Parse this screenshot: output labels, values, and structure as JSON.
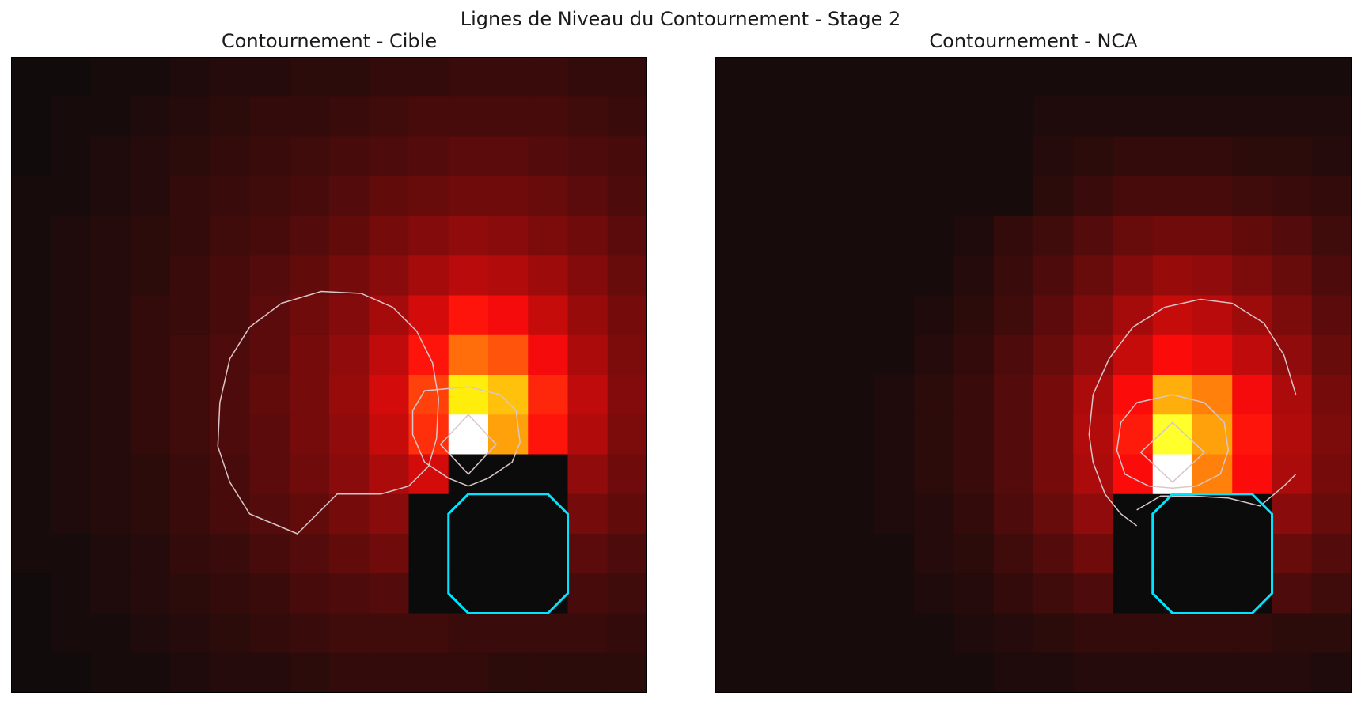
{
  "figure": {
    "suptitle": "Lignes de Niveau du Contournement - Stage 2"
  },
  "chart_data": [
    {
      "type": "heatmap",
      "title": "Contournement - Cible",
      "colormap": "hot",
      "grid_size": 16,
      "xticks": [],
      "yticks": [],
      "values": [
        [
          0.01,
          0.01,
          0.02,
          0.02,
          0.03,
          0.04,
          0.04,
          0.05,
          0.05,
          0.06,
          0.06,
          0.07,
          0.07,
          0.07,
          0.06,
          0.06
        ],
        [
          0.01,
          0.02,
          0.02,
          0.03,
          0.04,
          0.05,
          0.06,
          0.06,
          0.07,
          0.08,
          0.09,
          0.09,
          0.09,
          0.09,
          0.08,
          0.07
        ],
        [
          0.01,
          0.02,
          0.03,
          0.04,
          0.05,
          0.06,
          0.07,
          0.08,
          0.09,
          0.1,
          0.11,
          0.12,
          0.12,
          0.11,
          0.1,
          0.09
        ],
        [
          0.02,
          0.02,
          0.03,
          0.04,
          0.06,
          0.07,
          0.08,
          0.09,
          0.11,
          0.13,
          0.14,
          0.15,
          0.15,
          0.14,
          0.12,
          0.1
        ],
        [
          0.02,
          0.03,
          0.04,
          0.05,
          0.06,
          0.08,
          0.09,
          0.11,
          0.13,
          0.16,
          0.18,
          0.2,
          0.19,
          0.17,
          0.15,
          0.12
        ],
        [
          0.02,
          0.03,
          0.04,
          0.05,
          0.07,
          0.09,
          0.11,
          0.13,
          0.16,
          0.19,
          0.23,
          0.26,
          0.25,
          0.22,
          0.18,
          0.14
        ],
        [
          0.02,
          0.03,
          0.04,
          0.06,
          0.07,
          0.09,
          0.12,
          0.15,
          0.18,
          0.23,
          0.3,
          0.38,
          0.35,
          0.28,
          0.21,
          0.16
        ],
        [
          0.02,
          0.03,
          0.04,
          0.06,
          0.08,
          0.1,
          0.12,
          0.16,
          0.2,
          0.27,
          0.38,
          0.52,
          0.48,
          0.35,
          0.24,
          0.17
        ],
        [
          0.02,
          0.03,
          0.04,
          0.06,
          0.08,
          0.1,
          0.13,
          0.16,
          0.21,
          0.3,
          0.45,
          0.72,
          0.65,
          0.41,
          0.27,
          0.18
        ],
        [
          0.02,
          0.03,
          0.04,
          0.06,
          0.08,
          0.1,
          0.12,
          0.16,
          0.2,
          0.28,
          0.42,
          1.0,
          0.6,
          0.38,
          0.25,
          0.17
        ],
        [
          0.02,
          0.03,
          0.04,
          0.05,
          0.07,
          0.09,
          0.12,
          0.15,
          0.19,
          0.24,
          0.3,
          0.0,
          0.0,
          0.0,
          0.2,
          0.15
        ],
        [
          0.02,
          0.03,
          0.04,
          0.05,
          0.07,
          0.09,
          0.11,
          0.13,
          0.16,
          0.19,
          0.0,
          0.0,
          0.0,
          0.0,
          0.16,
          0.13
        ],
        [
          0.02,
          0.02,
          0.03,
          0.04,
          0.06,
          0.07,
          0.09,
          0.11,
          0.13,
          0.15,
          0.0,
          0.0,
          0.0,
          0.0,
          0.12,
          0.1
        ],
        [
          0.01,
          0.02,
          0.03,
          0.04,
          0.05,
          0.06,
          0.07,
          0.09,
          0.1,
          0.11,
          0.0,
          0.0,
          0.0,
          0.0,
          0.09,
          0.08
        ],
        [
          0.01,
          0.02,
          0.02,
          0.03,
          0.04,
          0.05,
          0.06,
          0.07,
          0.08,
          0.08,
          0.08,
          0.07,
          0.07,
          0.07,
          0.07,
          0.06
        ],
        [
          0.01,
          0.01,
          0.02,
          0.02,
          0.03,
          0.04,
          0.04,
          0.05,
          0.06,
          0.06,
          0.06,
          0.06,
          0.05,
          0.05,
          0.05,
          0.05
        ]
      ],
      "contours": [
        {
          "level": 0.2,
          "points": [
            [
              7.2,
              12.0
            ],
            [
              6.0,
              11.5
            ],
            [
              5.5,
              10.7
            ],
            [
              5.2,
              9.8
            ],
            [
              5.25,
              8.7
            ],
            [
              5.5,
              7.6
            ],
            [
              6.0,
              6.8
            ],
            [
              6.8,
              6.2
            ],
            [
              7.8,
              5.9
            ],
            [
              8.8,
              5.95
            ],
            [
              9.6,
              6.3
            ],
            [
              10.2,
              6.9
            ],
            [
              10.6,
              7.7
            ],
            [
              10.75,
              8.6
            ],
            [
              10.7,
              9.6
            ],
            [
              10.5,
              10.3
            ],
            [
              10.0,
              10.8
            ],
            [
              9.3,
              11.0
            ],
            [
              8.2,
              11.0
            ]
          ],
          "closed": true,
          "color": "#d9c6c8"
        },
        {
          "level": 0.45,
          "points": [
            [
              11.5,
              8.3
            ],
            [
              12.3,
              8.5
            ],
            [
              12.7,
              8.9
            ],
            [
              12.8,
              9.7
            ],
            [
              12.6,
              10.2
            ],
            [
              12.0,
              10.6
            ],
            [
              11.5,
              10.8
            ],
            [
              11.0,
              10.6
            ],
            [
              10.4,
              10.2
            ],
            [
              10.1,
              9.5
            ],
            [
              10.1,
              8.9
            ],
            [
              10.4,
              8.4
            ]
          ],
          "closed": true,
          "color": "#d9c6c8"
        },
        {
          "level": 0.8,
          "points": [
            [
              11.5,
              9.0
            ],
            [
              12.2,
              9.75
            ],
            [
              11.5,
              10.5
            ],
            [
              10.8,
              9.75
            ]
          ],
          "closed": true,
          "color": "#d9c6c8"
        }
      ],
      "obstacle": {
        "color": "#00e5ff",
        "points": [
          [
            11.5,
            11.0
          ],
          [
            13.5,
            11.0
          ],
          [
            14.0,
            11.5
          ],
          [
            14.0,
            13.5
          ],
          [
            13.5,
            14.0
          ],
          [
            11.5,
            14.0
          ],
          [
            11.0,
            13.5
          ],
          [
            11.0,
            11.5
          ]
        ]
      }
    },
    {
      "type": "heatmap",
      "title": "Contournement - NCA",
      "colormap": "hot",
      "grid_size": 16,
      "xticks": [],
      "yticks": [],
      "values": [
        [
          0.02,
          0.02,
          0.02,
          0.02,
          0.02,
          0.02,
          0.02,
          0.02,
          0.02,
          0.02,
          0.02,
          0.02,
          0.02,
          0.02,
          0.02,
          0.02
        ],
        [
          0.02,
          0.02,
          0.02,
          0.02,
          0.02,
          0.02,
          0.02,
          0.02,
          0.03,
          0.03,
          0.03,
          0.03,
          0.03,
          0.03,
          0.03,
          0.03
        ],
        [
          0.02,
          0.02,
          0.02,
          0.02,
          0.02,
          0.02,
          0.02,
          0.02,
          0.04,
          0.05,
          0.06,
          0.06,
          0.06,
          0.05,
          0.05,
          0.04
        ],
        [
          0.02,
          0.02,
          0.02,
          0.02,
          0.02,
          0.02,
          0.02,
          0.02,
          0.05,
          0.07,
          0.09,
          0.09,
          0.09,
          0.08,
          0.07,
          0.06
        ],
        [
          0.02,
          0.02,
          0.02,
          0.02,
          0.02,
          0.02,
          0.03,
          0.06,
          0.08,
          0.11,
          0.14,
          0.15,
          0.15,
          0.13,
          0.11,
          0.08
        ],
        [
          0.02,
          0.02,
          0.02,
          0.02,
          0.02,
          0.02,
          0.04,
          0.07,
          0.1,
          0.14,
          0.18,
          0.21,
          0.2,
          0.17,
          0.14,
          0.1
        ],
        [
          0.02,
          0.02,
          0.02,
          0.02,
          0.02,
          0.03,
          0.05,
          0.08,
          0.12,
          0.17,
          0.23,
          0.28,
          0.26,
          0.22,
          0.17,
          0.12
        ],
        [
          0.02,
          0.02,
          0.02,
          0.02,
          0.02,
          0.04,
          0.06,
          0.1,
          0.14,
          0.2,
          0.28,
          0.36,
          0.33,
          0.27,
          0.2,
          0.14
        ],
        [
          0.02,
          0.02,
          0.02,
          0.02,
          0.03,
          0.05,
          0.07,
          0.11,
          0.16,
          0.24,
          0.36,
          0.62,
          0.55,
          0.35,
          0.24,
          0.16
        ],
        [
          0.02,
          0.02,
          0.02,
          0.02,
          0.03,
          0.05,
          0.07,
          0.11,
          0.16,
          0.25,
          0.39,
          0.78,
          0.6,
          0.38,
          0.25,
          0.17
        ],
        [
          0.02,
          0.02,
          0.02,
          0.02,
          0.03,
          0.05,
          0.07,
          0.11,
          0.16,
          0.24,
          0.36,
          1.0,
          0.55,
          0.36,
          0.24,
          0.16
        ],
        [
          0.02,
          0.02,
          0.02,
          0.02,
          0.03,
          0.04,
          0.06,
          0.1,
          0.14,
          0.2,
          0.0,
          0.0,
          0.0,
          0.0,
          0.19,
          0.14
        ],
        [
          0.02,
          0.02,
          0.02,
          0.02,
          0.02,
          0.04,
          0.05,
          0.08,
          0.11,
          0.15,
          0.0,
          0.0,
          0.0,
          0.0,
          0.14,
          0.11
        ],
        [
          0.02,
          0.02,
          0.02,
          0.02,
          0.02,
          0.03,
          0.04,
          0.06,
          0.08,
          0.1,
          0.0,
          0.0,
          0.0,
          0.0,
          0.1,
          0.08
        ],
        [
          0.02,
          0.02,
          0.02,
          0.02,
          0.02,
          0.02,
          0.03,
          0.04,
          0.05,
          0.06,
          0.06,
          0.06,
          0.06,
          0.06,
          0.05,
          0.05
        ],
        [
          0.02,
          0.02,
          0.02,
          0.02,
          0.02,
          0.02,
          0.02,
          0.03,
          0.03,
          0.04,
          0.04,
          0.04,
          0.04,
          0.04,
          0.04,
          0.03
        ]
      ],
      "contours": [
        {
          "level": 0.2,
          "points": [
            [
              10.6,
              11.8
            ],
            [
              10.2,
              11.5
            ],
            [
              9.8,
              11.0
            ],
            [
              9.5,
              10.2
            ],
            [
              9.4,
              9.5
            ],
            [
              9.5,
              8.5
            ],
            [
              9.9,
              7.6
            ],
            [
              10.5,
              6.8
            ],
            [
              11.3,
              6.3
            ],
            [
              12.2,
              6.1
            ],
            [
              13.0,
              6.2
            ],
            [
              13.8,
              6.7
            ],
            [
              14.3,
              7.5
            ],
            [
              14.6,
              8.5
            ]
          ],
          "closed": false,
          "color": "#d9c6c8"
        },
        {
          "level": 0.2,
          "points": [
            [
              14.6,
              10.5
            ],
            [
              14.3,
              10.8
            ],
            [
              13.7,
              11.3
            ],
            [
              12.9,
              11.1
            ],
            [
              12.0,
              11.05
            ],
            [
              11.2,
              11.05
            ],
            [
              10.6,
              11.4
            ]
          ],
          "closed": false,
          "color": "#d9c6c8"
        },
        {
          "level": 0.45,
          "points": [
            [
              11.5,
              8.5
            ],
            [
              12.3,
              8.7
            ],
            [
              12.8,
              9.2
            ],
            [
              12.9,
              9.9
            ],
            [
              12.7,
              10.5
            ],
            [
              12.1,
              10.8
            ],
            [
              11.5,
              10.85
            ],
            [
              10.9,
              10.8
            ],
            [
              10.3,
              10.5
            ],
            [
              10.1,
              9.9
            ],
            [
              10.2,
              9.2
            ],
            [
              10.6,
              8.7
            ]
          ],
          "closed": true,
          "color": "#d9c6c8"
        },
        {
          "level": 0.8,
          "points": [
            [
              11.5,
              9.2
            ],
            [
              12.3,
              9.95
            ],
            [
              11.5,
              10.7
            ],
            [
              10.7,
              9.95
            ]
          ],
          "closed": true,
          "color": "#d9c6c8"
        }
      ],
      "obstacle": {
        "color": "#00e5ff",
        "points": [
          [
            11.5,
            11.0
          ],
          [
            13.5,
            11.0
          ],
          [
            14.0,
            11.5
          ],
          [
            14.0,
            13.5
          ],
          [
            13.5,
            14.0
          ],
          [
            11.5,
            14.0
          ],
          [
            11.0,
            13.5
          ],
          [
            11.0,
            11.5
          ]
        ]
      }
    }
  ]
}
